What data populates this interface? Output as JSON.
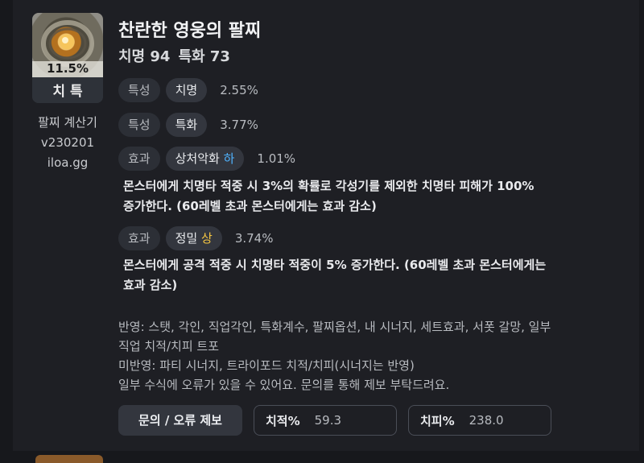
{
  "item": {
    "percent": "11.5%",
    "label": "치 특",
    "icon": "bracelet-icon"
  },
  "side": {
    "line1": "팔찌 계산기",
    "line2": "v230201",
    "line3": "iloa.gg"
  },
  "title": "찬란한 영웅의 팔찌",
  "subtitle": {
    "crit": "치명 94",
    "spec": "특화 73"
  },
  "stats": [
    {
      "type": "특성",
      "name": "치명",
      "value": "2.55%"
    },
    {
      "type": "특성",
      "name": "특화",
      "value": "3.77%"
    },
    {
      "type": "효과",
      "name": "상처악화",
      "grade": "하",
      "value": "1.01%",
      "desc1": "몬스터에게 치명타 적중 시 3%의 확률로 각성기를 제외한 치명타 피해가 100%",
      "desc2": "증가한다. (60레벨 초과 몬스터에게는 효과 감소)"
    },
    {
      "type": "효과",
      "name": "정밀",
      "grade": "상",
      "value": "3.74%",
      "desc1": "몬스터에게 공격 적중 시 치명타 적중이 5% 증가한다. (60레벨 초과 몬스터에게는",
      "desc2": "효과 감소)"
    }
  ],
  "notes": {
    "line1": "반영: 스탯, 각인, 직업각인, 특화계수, 팔찌옵션, 내 시너지, 세트효과, 서폿 갈망, 일부",
    "line2": "직업 치적/치피 트포",
    "line3": "미반영: 파티 시너지, 트라이포드 치적/치피(시너지는 반영)",
    "line4": "일부 수식에 오류가 있을 수 있어요. 문의를 통해 제보 부탁드려요."
  },
  "footer": {
    "report_button": "문의 / 오류 제보",
    "crit_rate_label": "치적%",
    "crit_rate_value": "59.3",
    "crit_dmg_label": "치피%",
    "crit_dmg_value": "238.0"
  },
  "colors": {
    "grade_low": "#4fb3ff",
    "grade_high": "#f4c542",
    "background": "#1e1f24"
  }
}
